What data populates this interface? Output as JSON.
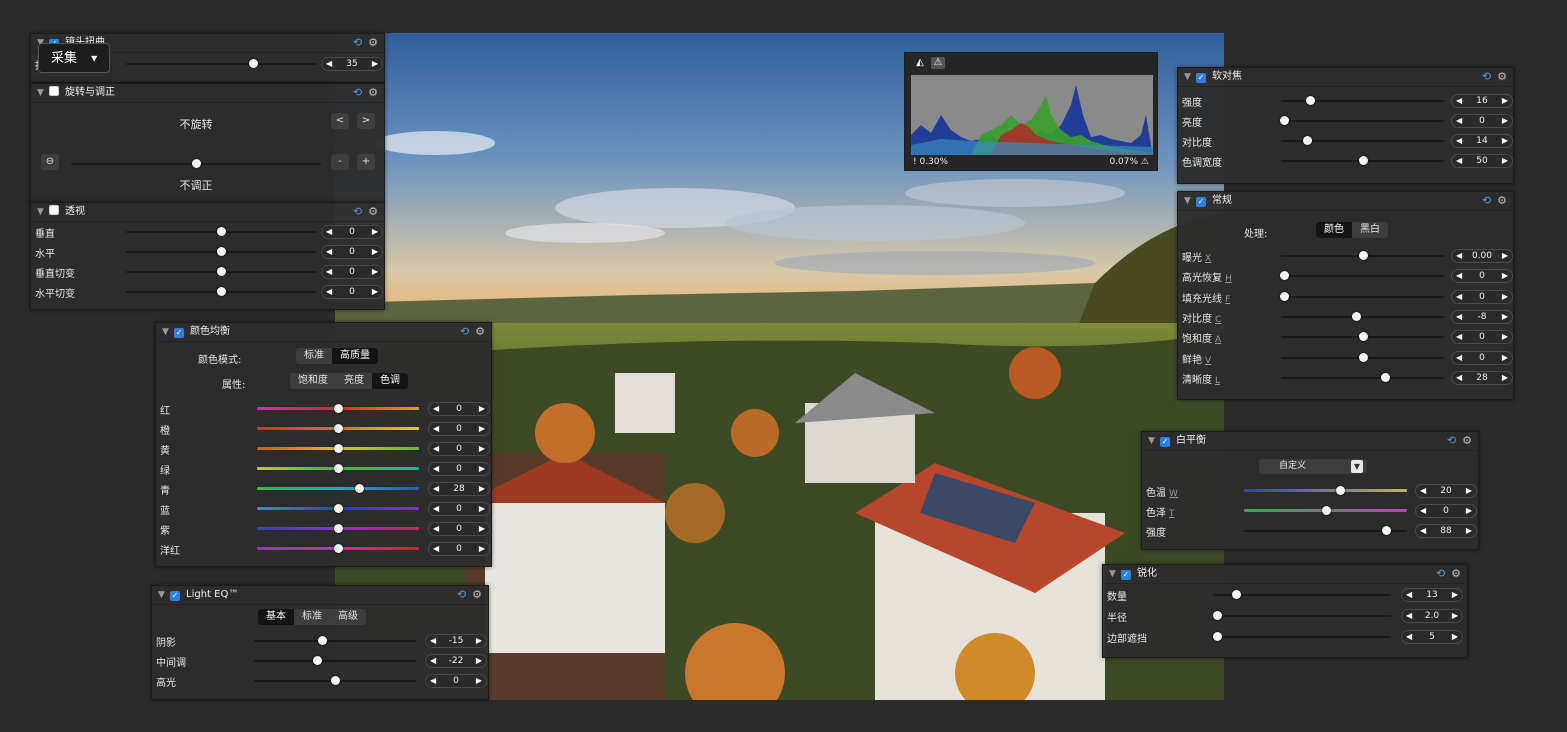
{
  "capture_button": {
    "label": "采集",
    "caret": "▾"
  },
  "lens_panel": {
    "title": "镜头扭曲",
    "row_label": "扭曲",
    "value": "35",
    "slider": 0.67
  },
  "rotate_panel": {
    "title": "旋转与调正",
    "rotation_text": "不旋转",
    "level_text": "不调正",
    "prev": "<",
    "next": ">",
    "minus": "-",
    "plus": "+",
    "level_slider": 0.5
  },
  "perspective_panel": {
    "title": "透视",
    "rows": [
      {
        "label": "垂直",
        "value": "0",
        "slider": 0.5
      },
      {
        "label": "水平",
        "value": "0",
        "slider": 0.5
      },
      {
        "label": "垂直切变",
        "value": "0",
        "slider": 0.5
      },
      {
        "label": "水平切变",
        "value": "0",
        "slider": 0.5
      }
    ]
  },
  "color_balance": {
    "title": "颜色均衡",
    "mode_label": "颜色模式:",
    "modes": [
      "标准",
      "高质量"
    ],
    "attr_label": "属性:",
    "attrs": [
      "饱和度",
      "亮度",
      "色调"
    ],
    "rows": [
      {
        "label": "红",
        "value": "0",
        "slider": 0.5,
        "grad": "#d62aa8,#d42a2a,#e0a020"
      },
      {
        "label": "橙",
        "value": "0",
        "slider": 0.5,
        "grad": "#d03030,#e07020,#d8d020"
      },
      {
        "label": "黄",
        "value": "0",
        "slider": 0.5,
        "grad": "#e05020,#d8c020,#60c020"
      },
      {
        "label": "绿",
        "value": "0",
        "slider": 0.5,
        "grad": "#c8c820,#30c030,#20b0a0"
      },
      {
        "label": "青",
        "value": "28",
        "slider": 0.63,
        "grad": "#30c040,#20b0c0,#3050d0"
      },
      {
        "label": "蓝",
        "value": "0",
        "slider": 0.5,
        "grad": "#20a0c0,#2040d0,#8030d0"
      },
      {
        "label": "紫",
        "value": "0",
        "slider": 0.5,
        "grad": "#3040d0,#9030d0,#d02060"
      },
      {
        "label": "洋红",
        "value": "0",
        "slider": 0.5,
        "grad": "#9030d0,#d030a0,#d02020"
      }
    ]
  },
  "light_eq": {
    "title": "Light EQ™",
    "modes": [
      "基本",
      "标准",
      "高级"
    ],
    "rows": [
      {
        "label": "阴影",
        "value": "-15",
        "slider": 0.42
      },
      {
        "label": "中间调",
        "value": "-22",
        "slider": 0.39
      },
      {
        "label": "高光",
        "value": "0",
        "slider": 0.5
      }
    ]
  },
  "histogram": {
    "left_value": "0.30%",
    "right_value": "0.07%"
  },
  "soft_focus": {
    "title": "软对焦",
    "rows": [
      {
        "label": "强度",
        "value": "16",
        "slider": 0.18
      },
      {
        "label": "亮度",
        "value": "0",
        "slider": 0.02
      },
      {
        "label": "对比度",
        "value": "14",
        "slider": 0.16
      },
      {
        "label": "色调宽度",
        "value": "50",
        "slider": 0.5
      }
    ]
  },
  "general": {
    "title": "常规",
    "process_label": "处理:",
    "process_modes": [
      "颜色",
      "黑白"
    ],
    "rows": [
      {
        "label": "曝光",
        "key": "X",
        "value": "0.00",
        "slider": 0.5
      },
      {
        "label": "高光恢复",
        "key": "H",
        "value": "0",
        "slider": 0.02
      },
      {
        "label": "填充光线",
        "key": "F",
        "value": "0",
        "slider": 0.02
      },
      {
        "label": "对比度",
        "key": "C",
        "value": "-8",
        "slider": 0.46
      },
      {
        "label": "饱和度",
        "key": "A",
        "value": "0",
        "slider": 0.5
      },
      {
        "label": "鲜艳",
        "key": "V",
        "value": "0",
        "slider": 0.5
      },
      {
        "label": "清晰度",
        "key": "L",
        "value": "28",
        "slider": 0.64
      }
    ]
  },
  "white_balance": {
    "title": "白平衡",
    "preset": "自定义",
    "rows": [
      {
        "label": "色温",
        "key": "W",
        "value": "20",
        "slider": 0.59,
        "grad": "#3040c0,#c0b060"
      },
      {
        "label": "色泽",
        "key": "T",
        "value": "0",
        "slider": 0.5,
        "grad": "#30b040,#c040c0"
      },
      {
        "label": "强度",
        "key": "",
        "value": "88",
        "slider": 0.87,
        "grad": ""
      }
    ]
  },
  "sharpen": {
    "title": "锐化",
    "rows": [
      {
        "label": "数量",
        "value": "13",
        "slider": 0.13
      },
      {
        "label": "半径",
        "value": "2.0",
        "slider": 0.02
      },
      {
        "label": "边部遮挡",
        "value": "5",
        "slider": 0.02
      }
    ]
  },
  "icons": {
    "reset": "⟲",
    "gear": "⚙",
    "triangle": "▼",
    "check": "✓",
    "left": "◀",
    "right": "▶",
    "level": "⊖"
  },
  "colors": {
    "accent": "#2f7fdc",
    "panel_bg": "#2c2c2c",
    "page_bg": "#2b2b2b"
  }
}
